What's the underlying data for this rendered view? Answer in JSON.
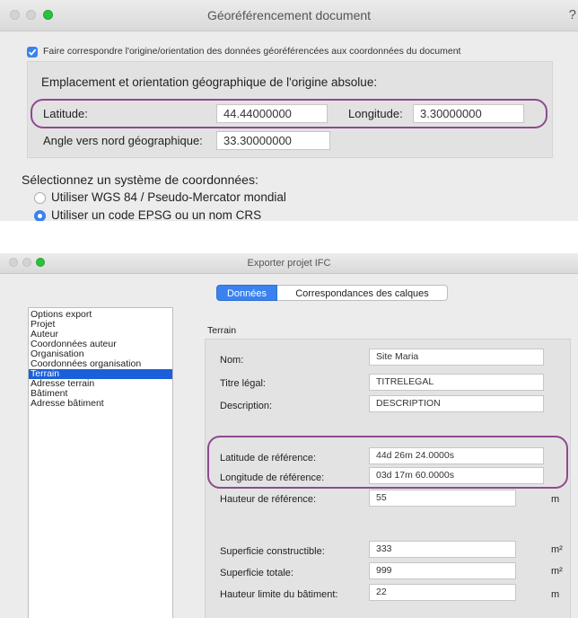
{
  "geo_dialog": {
    "title": "Géoréférencement document",
    "match_checkbox": {
      "checked": true,
      "label": "Faire correspondre l'origine/orientation des données géoréférencées aux coordonnées du document"
    },
    "section_heading": "Emplacement et orientation géographique de l'origine absolue:",
    "latitude_label": "Latitude:",
    "latitude_value": "44.44000000",
    "longitude_label": "Longitude:",
    "longitude_value": "3.30000000",
    "angle_label": "Angle vers nord géographique:",
    "angle_value": "33.30000000",
    "coord_system_heading": "Sélectionnez un système de coordonnées:",
    "radio_options": [
      {
        "label": "Utiliser WGS 84 / Pseudo-Mercator mondial",
        "selected": false
      },
      {
        "label": "Utiliser un code EPSG ou un nom CRS",
        "selected": true
      }
    ]
  },
  "ifc_dialog": {
    "title": "Exporter projet IFC",
    "tabs": [
      {
        "label": "Données",
        "active": true
      },
      {
        "label": "Correspondances des calques",
        "active": false
      }
    ],
    "sidebar_items": [
      "Options export",
      "Projet",
      "Auteur",
      "Coordonnées auteur",
      "Organisation",
      "Coordonnées organisation",
      "Terrain",
      "Adresse terrain",
      "Bâtiment",
      "Adresse bâtiment"
    ],
    "selected_sidebar_index": 6,
    "panel_title": "Terrain",
    "nom_label": "Nom:",
    "nom_value": "Site Maria",
    "titre_label": "Titre légal:",
    "titre_value": "TITRELEGAL",
    "description_label": "Description:",
    "description_value": "DESCRIPTION",
    "lat_ref_label": "Latitude de référence:",
    "lat_ref_value": "44d 26m 24.0000s",
    "lon_ref_label": "Longitude de référence:",
    "lon_ref_value": "03d 17m 60.0000s",
    "hauteur_ref_label": "Hauteur de référence:",
    "hauteur_ref_value": "55",
    "hauteur_ref_unit": "m",
    "superficie_constr_label": "Superficie constructible:",
    "superficie_constr_value": "333",
    "superficie_constr_unit": "m²",
    "superficie_totale_label": "Superficie totale:",
    "superficie_totale_value": "999",
    "superficie_totale_unit": "m²",
    "hauteur_limite_label": "Hauteur limite du bâtiment:",
    "hauteur_limite_value": "22",
    "hauteur_limite_unit": "m"
  },
  "colors": {
    "accent_blue": "#3a82f0",
    "selection_blue": "#1b60d8",
    "highlight_purple": "#8e4a8e",
    "window_bg": "#ececec"
  }
}
